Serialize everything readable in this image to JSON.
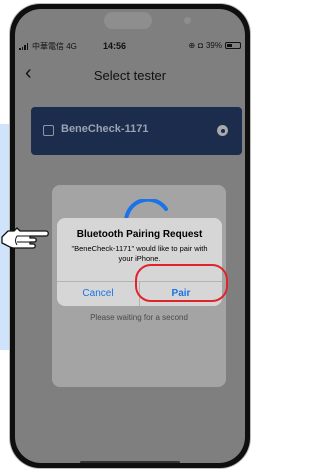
{
  "status_bar": {
    "carrier": "中華電信 4G",
    "time": "14:56",
    "battery_percent": "39%",
    "battery_level": 0.39
  },
  "nav": {
    "back_icon": "chevron-left-icon",
    "title": "Select tester"
  },
  "device": {
    "name": "BeneCheck-1171"
  },
  "loading": {
    "message": "Please waiting for a second"
  },
  "alert": {
    "title": "Bluetooth Pairing Request",
    "message": "\"BeneCheck-1171\" would like to pair with your iPhone.",
    "cancel_label": "Cancel",
    "pair_label": "Pair"
  },
  "colors": {
    "accent": "#1a73e8",
    "highlight": "#e0242b",
    "card_bg": "#1b2c4d",
    "overlay": "#7f7f7f"
  }
}
